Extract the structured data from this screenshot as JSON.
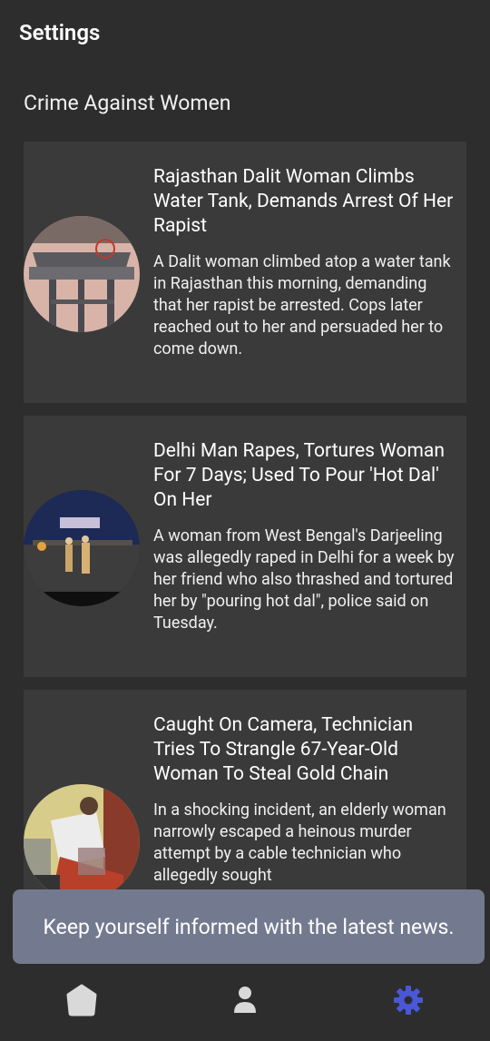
{
  "header": {
    "title": "Settings"
  },
  "section": {
    "title": "Crime Against Women"
  },
  "articles": [
    {
      "title": "Rajasthan Dalit Woman Climbs Water Tank, Demands Arrest Of Her Rapist",
      "description": "A Dalit woman climbed atop a water tank in Rajasthan this morning, demanding that her rapist be arrested. Cops later reached out to her and persuaded her to come down."
    },
    {
      "title": "Delhi Man Rapes, Tortures Woman For 7 Days; Used To Pour 'Hot Dal' On Her",
      "description": "A woman from West Bengal's Darjeeling was allegedly raped in Delhi for a week by her friend who also thrashed and tortured her by \"pouring hot dal\", police said on Tuesday."
    },
    {
      "title": "Caught On Camera, Technician Tries To Strangle 67-Year-Old Woman To Steal Gold Chain",
      "description": "In a shocking incident, an elderly woman narrowly escaped a heinous murder attempt by a cable technician who allegedly sought"
    }
  ],
  "toast": {
    "message": "Keep yourself informed with the latest news."
  },
  "nav": {
    "items": [
      {
        "icon": "home-icon",
        "active": false
      },
      {
        "icon": "person-icon",
        "active": false
      },
      {
        "icon": "gear-icon",
        "active": true
      }
    ],
    "colors": {
      "inactive": "#d9d9d9",
      "active": "#4a57d8"
    }
  }
}
